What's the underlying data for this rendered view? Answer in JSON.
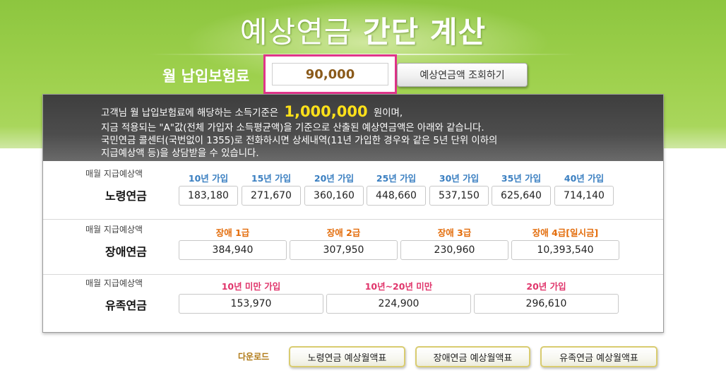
{
  "header": {
    "title_part1": "예상연금",
    "title_part2": "간단 계산",
    "pay_label": "월 납입보험료",
    "pay_value": "90,000",
    "query_button": "예상연금액 조회하기"
  },
  "summary": {
    "line1_prefix": "고객님 월 납입보험료에 해당하는 소득기준은",
    "income_value": "1,000,000",
    "line1_suffix": "원이며,",
    "line2": "지금 적용되는 \"A\"값(전체 가입자 소득평균액)을 기준으로 산출된 예상연금액은 아래와 같습니다.",
    "line3": "국민연금 콜센터(국번없이 1355)로 전화하시면 상세내역(11년 가입한 경우와 같은 5년 단위 이하의",
    "line4": "지급예상액 등)을 상담받을 수 있습니다."
  },
  "old_age": {
    "sub_label": "매월 지급예상액",
    "title": "노령연금",
    "headers": [
      "10년 가입",
      "15년 가입",
      "20년 가입",
      "25년 가입",
      "30년 가입",
      "35년 가입",
      "40년 가입"
    ],
    "values": [
      "183,180",
      "271,670",
      "360,160",
      "448,660",
      "537,150",
      "625,640",
      "714,140"
    ]
  },
  "disability": {
    "sub_label": "매월 지급예상액",
    "title": "장애연금",
    "headers": [
      "장애 1급",
      "장애 2급",
      "장애 3급",
      "장애 4급[일시금]"
    ],
    "values": [
      "384,940",
      "307,950",
      "230,960",
      "10,393,540"
    ]
  },
  "survivor": {
    "sub_label": "매월 지급예상액",
    "title": "유족연금",
    "headers": [
      "10년 미만 가입",
      "10년~20년 미만",
      "20년 가입"
    ],
    "values": [
      "153,970",
      "224,900",
      "296,610"
    ]
  },
  "download": {
    "label": "다운로드",
    "buttons": [
      "노령연금 예상월액표",
      "장애연금 예상월액표",
      "유족연금 예상월액표"
    ]
  },
  "colors": {
    "green": "#9fd14e",
    "highlight_border": "#e0358a",
    "income_yellow": "#ffe11a",
    "blue_header": "#3a7fc1",
    "orange_header": "#e36c0a",
    "pink_header": "#e0356b"
  }
}
